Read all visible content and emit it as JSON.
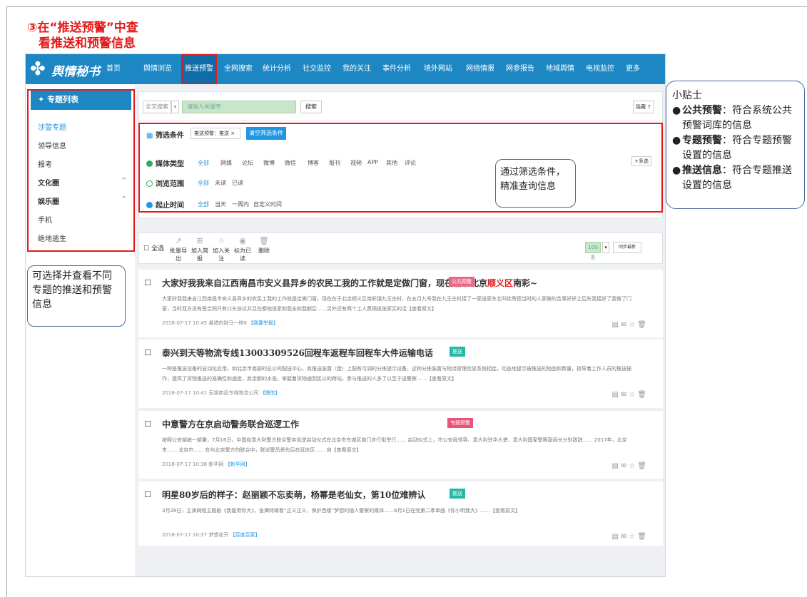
{
  "heading": {
    "line1": "③在“推送预警”中查",
    "line2": "看推送和预警信息"
  },
  "app": {
    "logo": "舆情秘书",
    "nav": [
      "首页",
      "舆情浏览",
      "推送预警",
      "全网搜索",
      "统计分析",
      "社交监控",
      "我的关注",
      "事件分析",
      "境外网站",
      "网络情报",
      "网参报告",
      "地域舆情",
      "电视监控",
      "更多"
    ]
  },
  "sidebar": {
    "header": "专题列表",
    "items": [
      {
        "label": "涉警专题",
        "chev": ""
      },
      {
        "label": "领导信息",
        "chev": ""
      },
      {
        "label": "报考",
        "chev": ""
      },
      {
        "label": "文化圈",
        "chev": "^"
      },
      {
        "label": "娱乐圈",
        "chev": "^"
      },
      {
        "label": "手机",
        "chev": ""
      },
      {
        "label": "绝地逃生",
        "chev": ""
      }
    ]
  },
  "search": {
    "scope": "全文搜索",
    "placeholder": "请输入关键字",
    "button": "搜索",
    "collapse": "隐藏 ↑"
  },
  "filters": {
    "label": "筛选条件",
    "current": "推送预警：推送 ×",
    "clear": "清空筛选条件",
    "media": {
      "label": "媒体类型",
      "options": [
        "全部",
        "网媒",
        "论坛",
        "微博",
        "微信",
        "博客",
        "报刊",
        "视频",
        "APP",
        "其他",
        "评论"
      ],
      "multi": "+多选"
    },
    "browse": {
      "label": "浏览范围",
      "options": [
        "全部",
        "未读",
        "已读"
      ]
    },
    "time": {
      "label": "起止时间",
      "options": [
        "全部",
        "当天",
        "一周内",
        "自定义时间"
      ]
    }
  },
  "toolbar": {
    "select_all": "全选",
    "actions": [
      "批量导出",
      "加入简报",
      "加入关注",
      "标为已读",
      "删除"
    ],
    "page_size": "100条",
    "per_page_extra": "同步最新"
  },
  "articles": [
    {
      "title": "大家好我我来自江西南昌市安义县异乡的农民工我的工作就是定做门窗，现在在于北京",
      "title_hl": "顺义区",
      "title_tail": "南彩~",
      "tag": "公共预警",
      "tag_color": "#e86a86",
      "body": "大家好我我来自江西南昌市安义县异乡的农民工我的工作就是定做门窗，现在在于北京顺义区南彩镇九王庄村，在五月九号我在九王庄村接了一家送家东北叫徐秀德当时的人家做的苦事好好之后失我接好了我做了门窗，当时双方没有签合同只有口头协议并且在都他说家和我全和我额后……另外还有两个工人黑隔说张家买的活【查看原文】",
      "meta_time": "2018-07-17 10:45",
      "meta_src": "悬错的财马一样8",
      "meta_link": "【我要举报】"
    },
    {
      "title": "泰兴到天等物流专线13003309526回程车返程车回程车大件运输电话",
      "title_hl": "",
      "title_tail": "",
      "tag": "推送",
      "tag_color": "#26b7a8",
      "body": "一种是推送设备的自动化应用，如北京市南部的总公司配送中心，其推送装置（盘）上配有可调的分拣提示设备，这种分拣装置与物流管理信息系统相连，动态地提示被推送的物品和数量，指导着工作人员的推送操作，提高了货物推送的准确性和速度，其余额的水准，掌握着货物通到民公的跨站，参与推送的人多了以至于送警察……【查看原文】",
      "meta_time": "2018-07-17 10:41",
      "meta_src": "无锡商运专线物流公司",
      "meta_link": "【微信】"
    },
    {
      "title": "中意警方在京启动警务联合巡逻工作",
      "title_hl": "",
      "title_tail": "",
      "tag": "专题预警",
      "tag_color": "#e8557a",
      "body": "按照公安部统一部署，7月16日，中国和意大利警方联合警务巡逻启动仪式在北京市东城区南门步行街举行…… 启动仪式上，市公安局领导、意大利驻华大使、意大利国家警察副局长分别致辞…… 2017年，北京市…… 北京市…… 在与北京警方的联合中，联巡警员将先后在延庆区…… 自【查看原文】",
      "meta_time": "2018-07-17 10:38",
      "meta_src": "新华网",
      "meta_link": "【新华网】"
    },
    {
      "title": "明星80岁后的样子：赵丽颖不忘卖萌，杨幂是老仙女，第10位难辨认",
      "title_hl": "",
      "title_tail": "",
      "tag": "推送",
      "tag_color": "#26b7a8",
      "body": "3月28日，主演网络主题剧《我能带你大》，张满特辑看“正义正义，保护西楼”梦想的插人警察的媒体……6月1日在完第二季单曲《你小明我大》……【查看原文】",
      "meta_time": "2018-07-17 10:37",
      "meta_src": "梦想花开",
      "meta_link": "【百度百家】"
    }
  ],
  "callouts": {
    "filter": "通过筛选条件，\n精准查询信息",
    "topic": "可选择并查看不同专题的推送和预警信息",
    "tips_title": "小贴士",
    "tips": [
      {
        "bold": "公共预警",
        "text": "：符合系统公共预警词库的信息"
      },
      {
        "bold": "专题预警",
        "text": "：符合专题预警设置的信息"
      },
      {
        "bold": "推送信息",
        "text": "：符合专题推送设置的信息"
      }
    ]
  },
  "colors": {
    "nav": "#1d87c4",
    "highlight": "#e31a1a",
    "link": "#2196e0"
  }
}
